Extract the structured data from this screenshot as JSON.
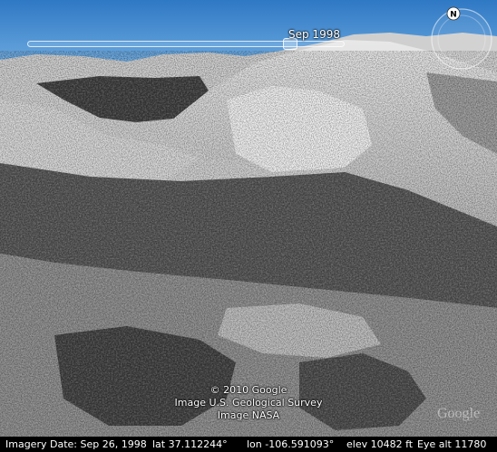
{
  "time_slider": {
    "label": "Sep 1998"
  },
  "compass": {
    "north_label": "N"
  },
  "attribution": {
    "line1": "© 2010 Google",
    "line2": "Image U.S. Geological Survey",
    "line3": "Image NASA",
    "logo": "Google"
  },
  "status_bar": {
    "imagery_date": "Imagery Date: Sep 26, 1998",
    "lat": "lat   37.112244°",
    "lon": "lon -106.591093°",
    "elev": "elev 10482 ft",
    "eye_alt": "Eye alt   11780"
  },
  "colors": {
    "sky": "#6aaee0",
    "status_bar_bg": "#000000",
    "overlay_text": "#ffffff"
  }
}
